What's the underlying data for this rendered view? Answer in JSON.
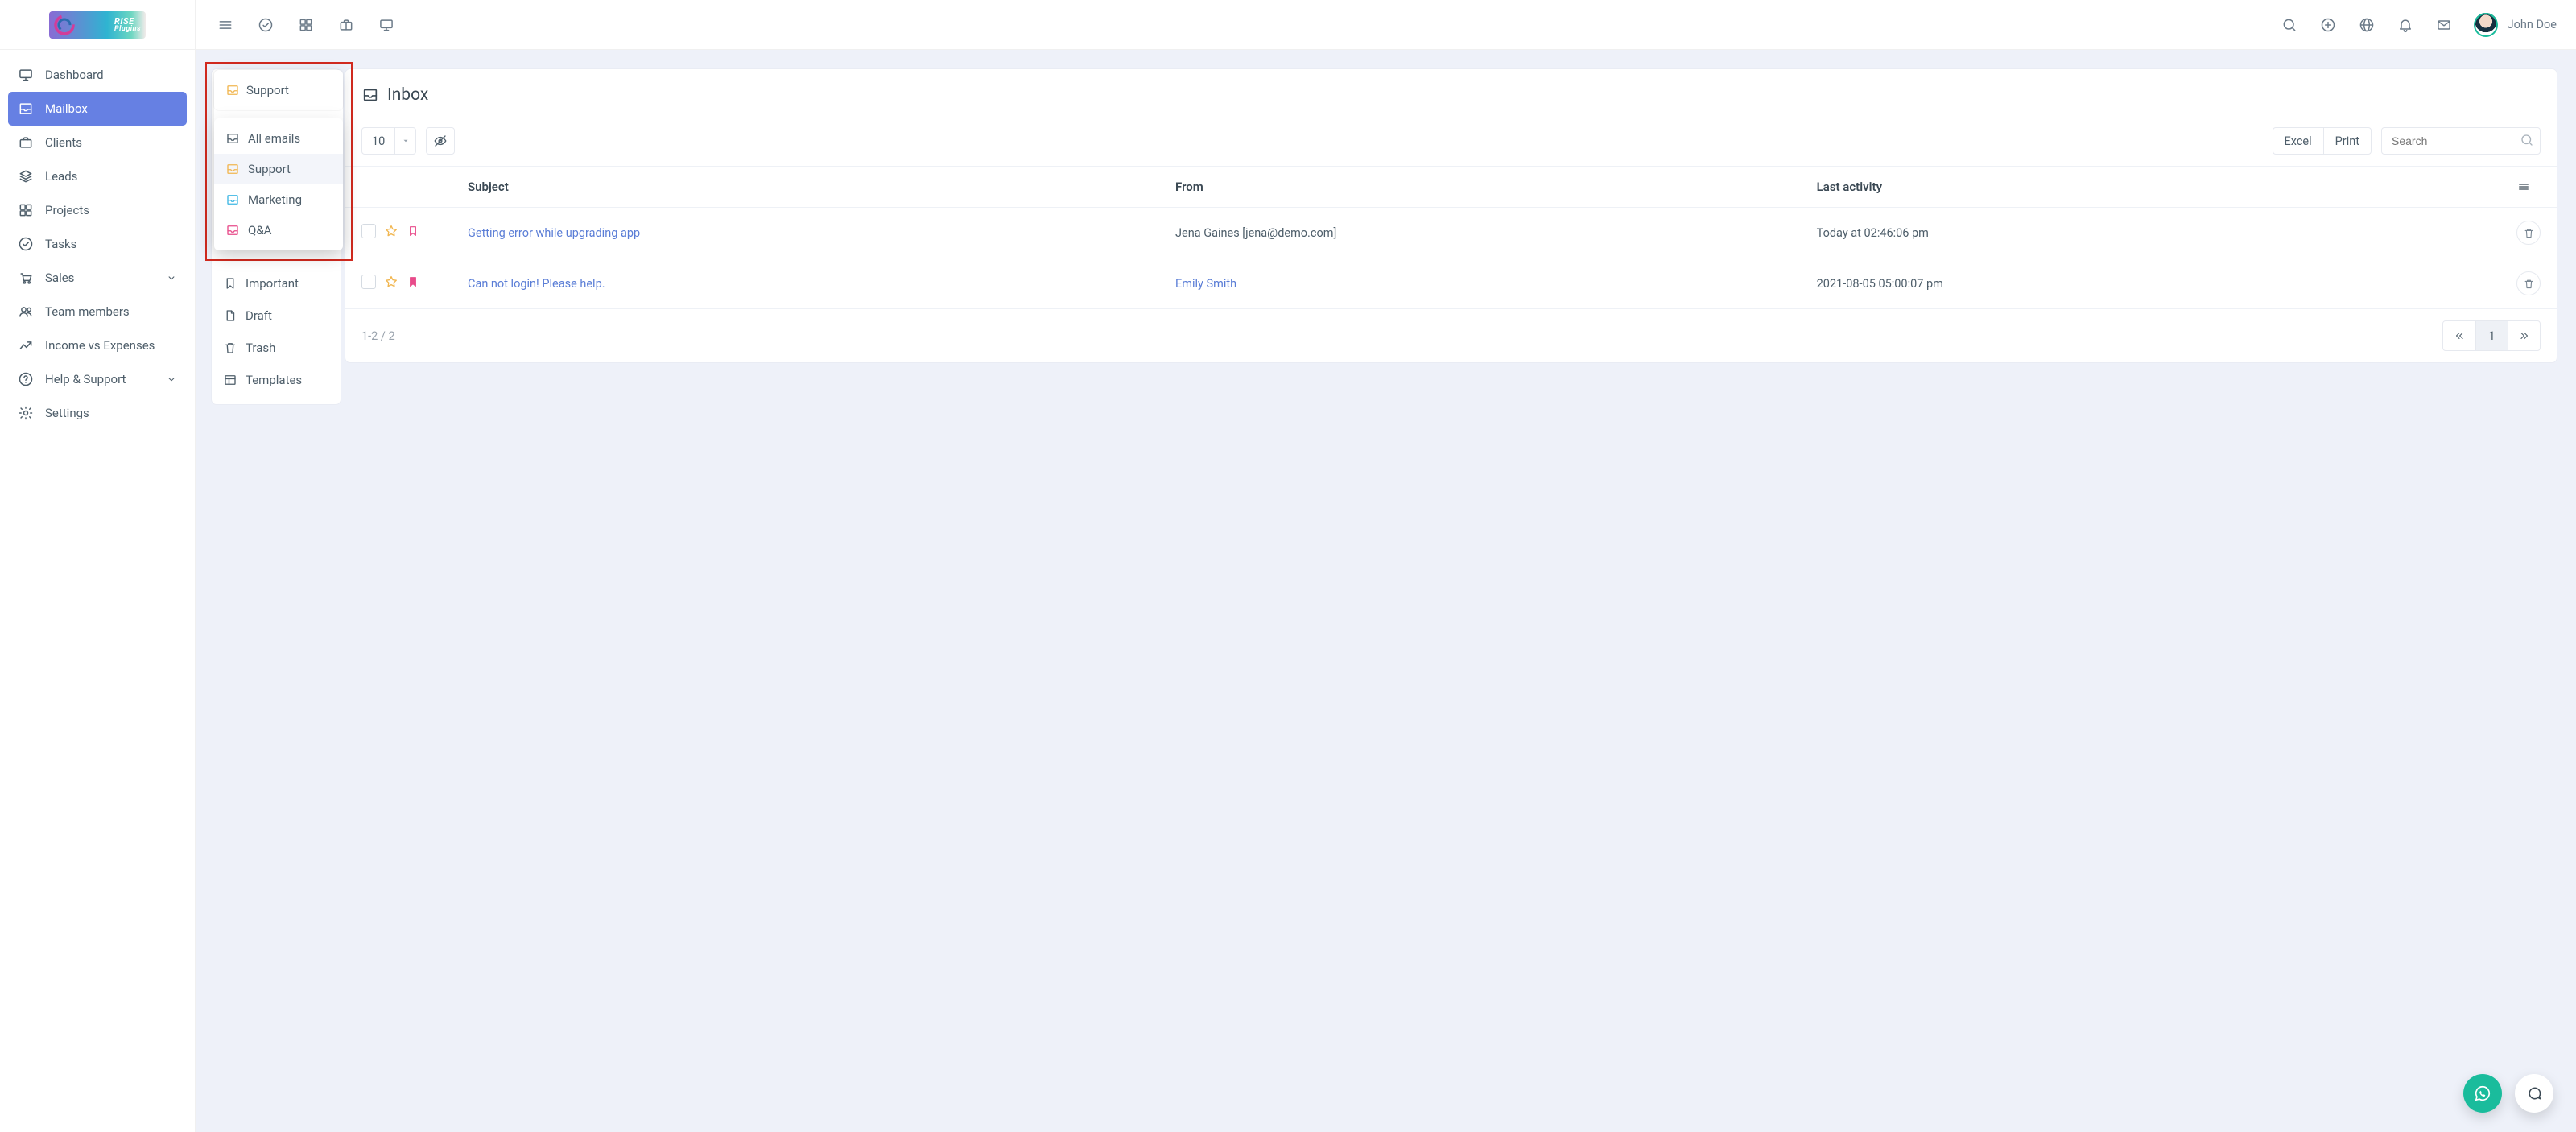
{
  "brand": {
    "line1": "RISE",
    "line2": "Plugins"
  },
  "user": {
    "name": "John Doe"
  },
  "sidebar": {
    "items": [
      {
        "label": "Dashboard"
      },
      {
        "label": "Mailbox"
      },
      {
        "label": "Clients"
      },
      {
        "label": "Leads"
      },
      {
        "label": "Projects"
      },
      {
        "label": "Tasks"
      },
      {
        "label": "Sales"
      },
      {
        "label": "Team members"
      },
      {
        "label": "Income vs Expenses"
      },
      {
        "label": "Help & Support"
      },
      {
        "label": "Settings"
      }
    ]
  },
  "mailSide": {
    "important": "Important",
    "draft": "Draft",
    "trash": "Trash",
    "templates": "Templates"
  },
  "selector": {
    "current": "Support",
    "options": [
      {
        "label": "All emails",
        "color": "#4e5e6a"
      },
      {
        "label": "Support",
        "color": "#f1b650"
      },
      {
        "label": "Marketing",
        "color": "#3eb7e4"
      },
      {
        "label": "Q&A",
        "color": "#e84b8a"
      }
    ]
  },
  "colors": {
    "accent": "#6680e3",
    "star": "#f1b650",
    "bookmarkOutline": "#e84b8a",
    "bookmarkFilled": "#e84b8a",
    "green": "#1abc9c"
  },
  "inbox": {
    "title": "Inbox",
    "pageSize": "10",
    "export": {
      "excel": "Excel",
      "print": "Print"
    },
    "search_placeholder": "Search",
    "columns": {
      "subject": "Subject",
      "from": "From",
      "last_activity": "Last activity"
    },
    "rows": [
      {
        "subject": "Getting error while upgrading app",
        "from": "Jena Gaines [jena@demo.com]",
        "from_link": false,
        "last": "Today at 02:46:06 pm",
        "bookmark_filled": false
      },
      {
        "subject": "Can not login! Please help.",
        "from": "Emily Smith",
        "from_link": true,
        "last": "2021-08-05 05:00:07 pm",
        "bookmark_filled": true
      }
    ],
    "footer": {
      "range": "1-2 / 2",
      "page": "1"
    }
  }
}
